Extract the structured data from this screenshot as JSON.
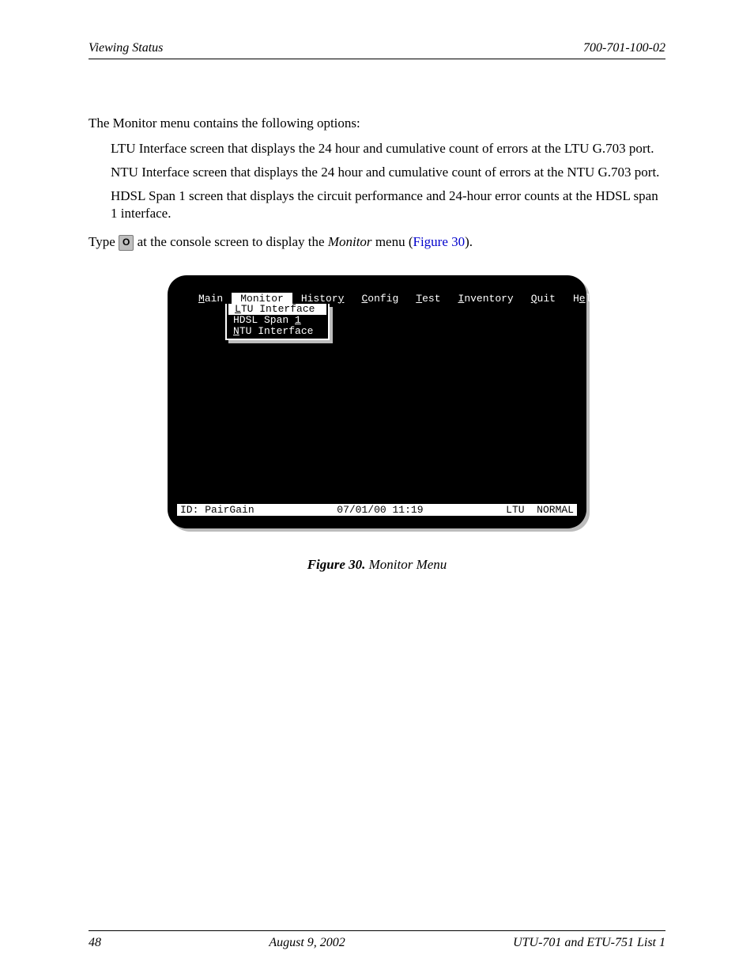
{
  "header": {
    "left": "Viewing Status",
    "right": "700-701-100-02"
  },
  "body": {
    "intro": "The Monitor menu contains the following options:",
    "options": [
      "LTU Interface screen that displays the 24 hour and cumulative count of errors at the LTU G.703 port.",
      "NTU Interface screen that displays the 24 hour and cumulative count of errors at the NTU G.703 port.",
      "HDSL Span 1 screen that displays the circuit performance and 24-hour error counts at the HDSL span 1 interface."
    ],
    "typeSentence": {
      "pre": "Type ",
      "key": "O",
      "mid": " at the console screen to display the ",
      "italic": "Monitor",
      "post1": " menu (",
      "figref": "Figure 30",
      "post2": ")."
    }
  },
  "terminal": {
    "menu": {
      "main": {
        "pre": "M",
        "rest": "ain"
      },
      "monitor": "Monitor",
      "history": {
        "pre": "Histor",
        "rest": "y"
      },
      "config": {
        "pre": "C",
        "rest": "onfig"
      },
      "test": {
        "pre": "T",
        "rest": "est"
      },
      "inventory": {
        "pre": "I",
        "rest": "nventory"
      },
      "quit": {
        "pre": "Q",
        "rest": "uit"
      },
      "help": {
        "pre": "H",
        "mid": "e",
        "rest": "lp"
      }
    },
    "dropdown": {
      "ltu": {
        "pre": "L",
        "rest": "TU Interface"
      },
      "hdsl": {
        "pre": "HDSL Span ",
        "rest": "1"
      },
      "ntu": {
        "pre": "N",
        "rest": "TU Interface"
      }
    },
    "status": {
      "id": "ID: PairGain",
      "datetime": "07/01/00 11:19",
      "right": "LTU  NORMAL"
    }
  },
  "caption": {
    "label": "Figure 30.",
    "text": "   Monitor Menu"
  },
  "footer": {
    "page": "48",
    "date": "August 9, 2002",
    "doc": "UTU-701 and ETU-751 List 1"
  }
}
